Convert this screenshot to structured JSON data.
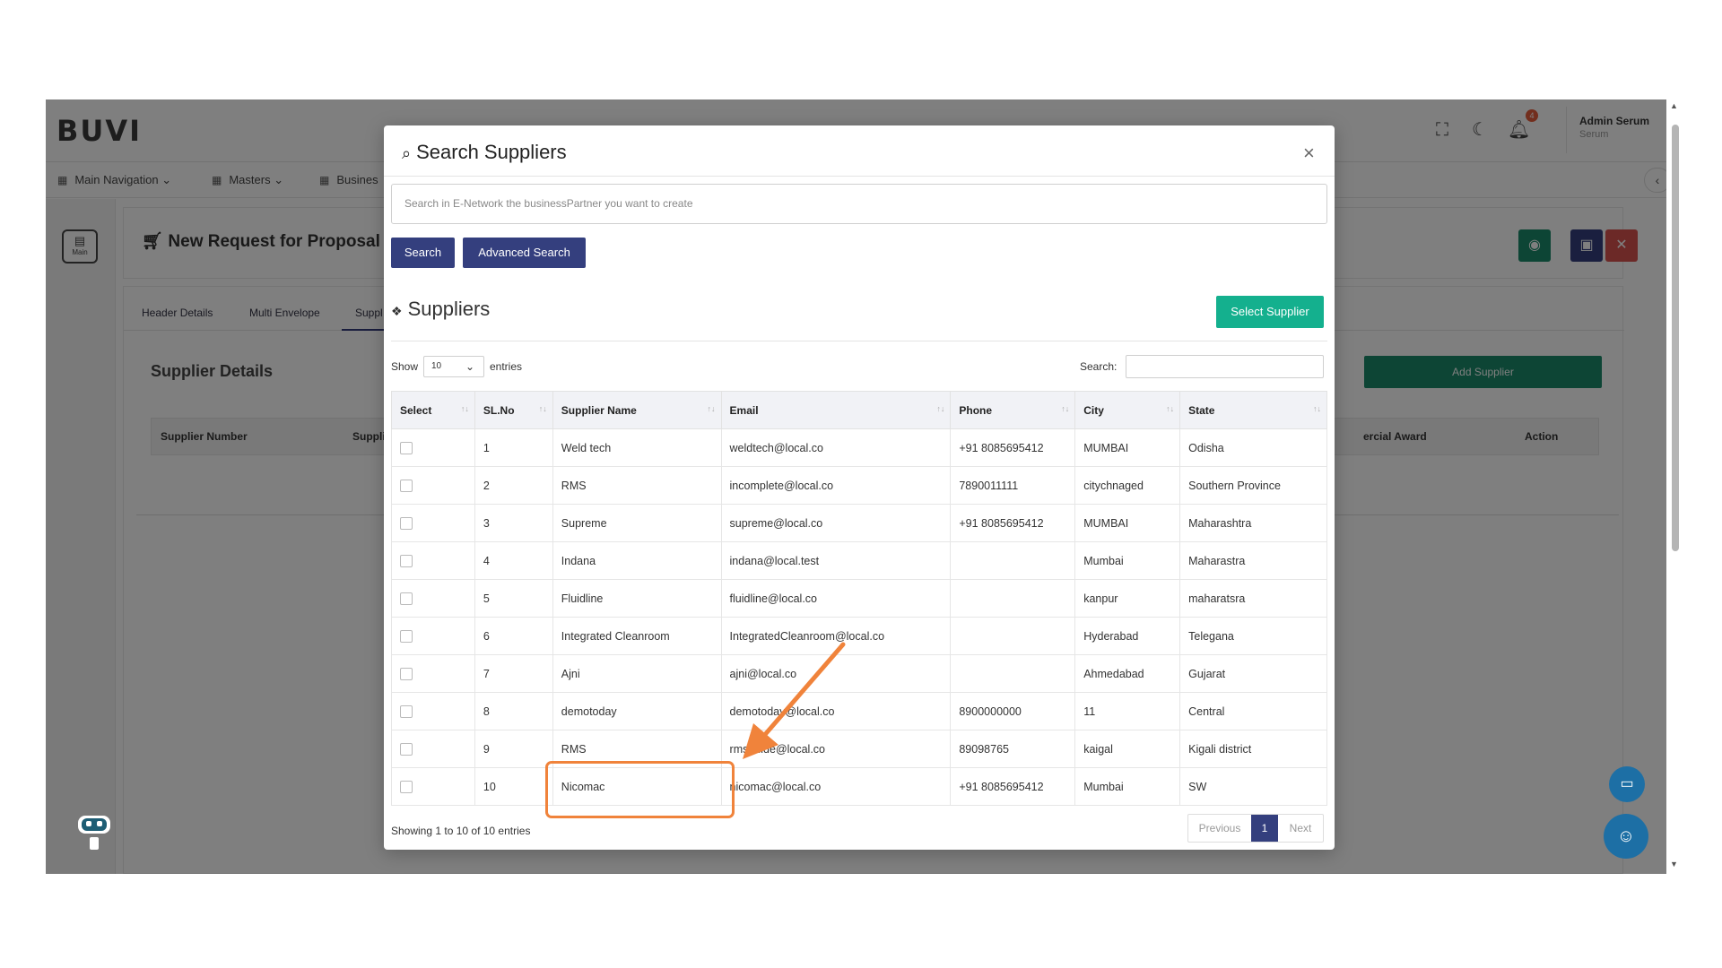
{
  "app": {
    "logo": "BUVI",
    "user_name": "Admin Serum",
    "user_sub": "Serum",
    "notification_count": "4",
    "nav": [
      {
        "label": "Main Navigation"
      },
      {
        "label": "Masters"
      },
      {
        "label": "Busines"
      }
    ],
    "side_main_label": "Main"
  },
  "page": {
    "title": "New Request for Proposal",
    "tabs": [
      "Header Details",
      "Multi Envelope",
      "Suppl"
    ],
    "section_title": "Supplier Details",
    "add_supplier_label": "Add Supplier",
    "bg_table_headers": [
      "Supplier Number",
      "Suppli",
      "ercial Award",
      "Action"
    ]
  },
  "modal": {
    "title": "Search Suppliers",
    "close_glyph": "×",
    "search_placeholder": "Search in E-Network the businessPartner you want to create",
    "search_button": "Search",
    "advanced_search_button": "Advanced Search",
    "suppliers_heading": "Suppliers",
    "select_supplier_button": "Select Supplier",
    "show_label": "Show",
    "entries_label": "entries",
    "page_length": "10",
    "table_search_label": "Search:",
    "columns": [
      "Select",
      "SL.No",
      "Supplier Name",
      "Email",
      "Phone",
      "City",
      "State"
    ],
    "rows": [
      {
        "sl": "1",
        "name": "Weld tech",
        "email": "weldtech@local.co",
        "phone": "+91 8085695412",
        "city": "MUMBAI",
        "state": "Odisha"
      },
      {
        "sl": "2",
        "name": "RMS",
        "email": "incomplete@local.co",
        "phone": "7890011111",
        "city": "citychnaged",
        "state": "Southern Province"
      },
      {
        "sl": "3",
        "name": "Supreme",
        "email": "supreme@local.co",
        "phone": "+91 8085695412",
        "city": "MUMBAI",
        "state": "Maharashtra"
      },
      {
        "sl": "4",
        "name": "Indana",
        "email": "indana@local.test",
        "phone": "",
        "city": "Mumbai",
        "state": "Maharastra"
      },
      {
        "sl": "5",
        "name": "Fluidline",
        "email": "fluidline@local.co",
        "phone": "",
        "city": "kanpur",
        "state": "maharatsra"
      },
      {
        "sl": "6",
        "name": "Integrated Cleanroom",
        "email": "IntegratedCleanroom@local.co",
        "phone": "",
        "city": "Hyderabad",
        "state": "Telegana"
      },
      {
        "sl": "7",
        "name": "Ajni",
        "email": "ajni@local.co",
        "phone": "",
        "city": "Ahmedabad",
        "state": "Gujarat"
      },
      {
        "sl": "8",
        "name": "demotoday",
        "email": "demotoday@local.co",
        "phone": "8900000000",
        "city": "11",
        "state": "Central"
      },
      {
        "sl": "9",
        "name": "RMS",
        "email": "rmsguide@local.co",
        "phone": "89098765",
        "city": "kaigal",
        "state": "Kigali district"
      },
      {
        "sl": "10",
        "name": "Nicomac",
        "email": "nicomac@local.co",
        "phone": "+91 8085695412",
        "city": "Mumbai",
        "state": "SW"
      }
    ],
    "showing_text": "Showing 1 to 10 of 10 entries",
    "pager": {
      "previous": "Previous",
      "current": "1",
      "next": "Next"
    }
  },
  "colors": {
    "primary": "#343f7e",
    "teal": "#14b08e",
    "annotation": "#f0833b"
  }
}
